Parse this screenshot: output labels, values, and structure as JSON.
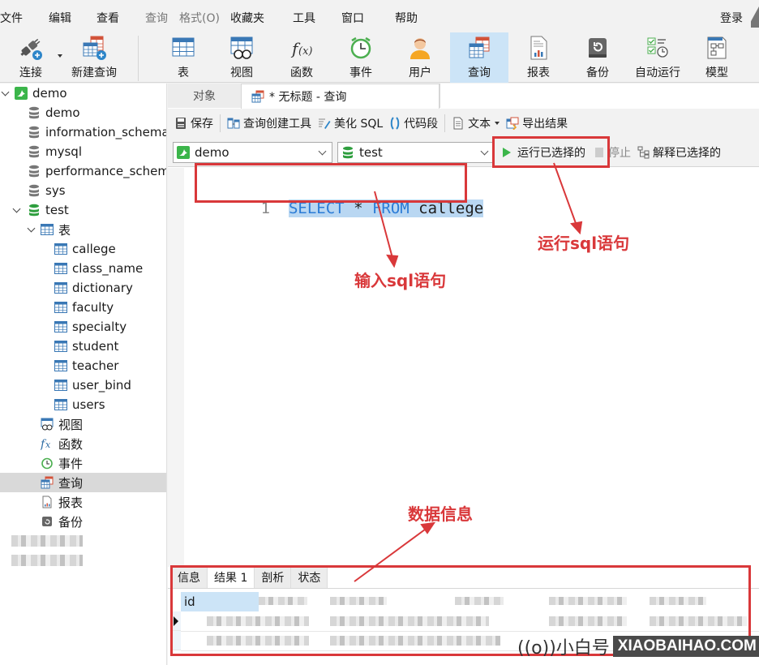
{
  "menu": {
    "items": [
      {
        "label": "文件",
        "enabled": true
      },
      {
        "label": "编辑",
        "enabled": true
      },
      {
        "label": "查看",
        "enabled": true
      },
      {
        "label": "查询",
        "enabled": false
      },
      {
        "label": "格式(O)",
        "enabled": false
      },
      {
        "label": "收藏夹",
        "enabled": true
      },
      {
        "label": "工具",
        "enabled": true
      },
      {
        "label": "窗口",
        "enabled": true
      },
      {
        "label": "帮助",
        "enabled": true
      }
    ],
    "login": "登录"
  },
  "toolbar": {
    "items": [
      {
        "label": "连接",
        "icon": "plug-connect-icon"
      },
      {
        "label": "新建查询",
        "icon": "new-query-icon"
      },
      {
        "label": "表",
        "icon": "table-icon"
      },
      {
        "label": "视图",
        "icon": "view-icon"
      },
      {
        "label": "函数",
        "icon": "function-icon"
      },
      {
        "label": "事件",
        "icon": "clock-event-icon"
      },
      {
        "label": "用户",
        "icon": "user-icon"
      },
      {
        "label": "查询",
        "icon": "query-icon",
        "active": true
      },
      {
        "label": "报表",
        "icon": "report-icon"
      },
      {
        "label": "备份",
        "icon": "backup-icon"
      },
      {
        "label": "自动运行",
        "icon": "automation-icon"
      },
      {
        "label": "模型",
        "icon": "model-icon"
      }
    ]
  },
  "sidebar": {
    "connection": "demo",
    "databases": [
      "demo",
      "information_schema",
      "mysql",
      "performance_schema",
      "sys",
      "test"
    ],
    "tables_label": "表",
    "tables": [
      "callege",
      "class_name",
      "dictionary",
      "faculty",
      "specialty",
      "student",
      "teacher",
      "user_bind",
      "users"
    ],
    "objects": [
      {
        "label": "视图",
        "icon": "view-icon"
      },
      {
        "label": "函数",
        "icon": "function-icon"
      },
      {
        "label": "事件",
        "icon": "clock-event-icon"
      },
      {
        "label": "查询",
        "icon": "query-icon",
        "selected": true
      },
      {
        "label": "报表",
        "icon": "report-icon"
      },
      {
        "label": "备份",
        "icon": "backup-icon"
      }
    ]
  },
  "tabs": {
    "objects": "对象",
    "query": "* 无标题 - 查询"
  },
  "query_toolbar": {
    "save": "保存",
    "builder": "查询创建工具",
    "beautify": "美化 SQL",
    "snippet": "代码段",
    "text": "文本",
    "export": "导出结果"
  },
  "selectors": {
    "connection": "demo",
    "database": "test",
    "run_selected": "运行已选择的",
    "stop": "停止",
    "explain_selected": "解释已选择的"
  },
  "editor": {
    "line_number": "1",
    "kw1": "SELECT",
    "star": " * ",
    "kw2": "FROM",
    "table": " callege"
  },
  "results": {
    "tabs": [
      "信息",
      "结果 1",
      "剖析",
      "状态"
    ],
    "active_tab": "结果 1",
    "first_column": "id"
  },
  "annotations": {
    "input_sql": "输入sql语句",
    "run_sql": "运行sql语句",
    "data_info": "数据信息"
  },
  "watermark": {
    "cn": "((o))小白号",
    "en": "XIAOBAIHAO.COM"
  },
  "colors": {
    "accent_selected": "#cce4f7",
    "annotation_red": "#d9383a",
    "keyword_blue": "#2a7bd6",
    "run_green": "#3bb54a"
  }
}
